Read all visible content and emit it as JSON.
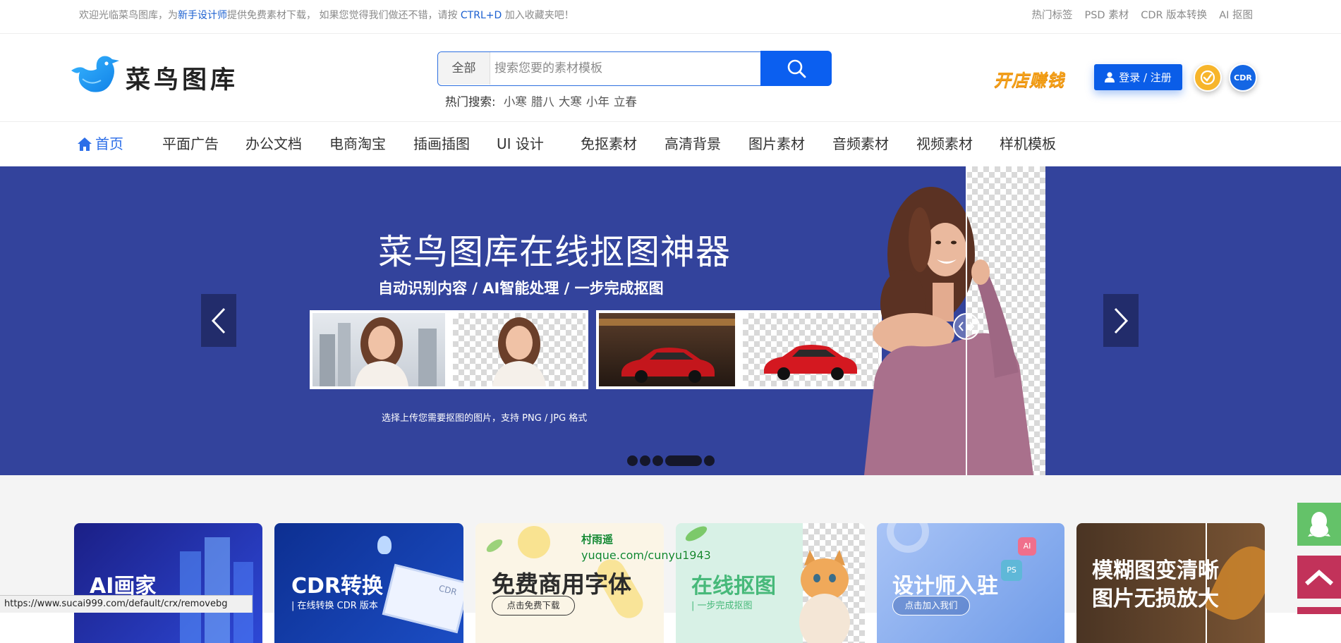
{
  "top_bar": {
    "welcome_prefix": "欢迎光临菜鸟图库，为",
    "welcome_link": "新手设计师",
    "welcome_mid": "提供免费素材下载， 如果您觉得我们做还不错，请按 ",
    "shortcut": "CTRL+D",
    "welcome_suffix": " 加入收藏夹吧！",
    "links": [
      "热门标签",
      "PSD 素材",
      "CDR 版本转换",
      "AI 抠图"
    ]
  },
  "header": {
    "logo_text": "菜鸟图库",
    "search": {
      "category": "全部",
      "placeholder": "搜索您要的素材模板"
    },
    "hot_search": {
      "label": "热门搜索:",
      "terms": [
        "小寒",
        "腊八",
        "大寒",
        "小年",
        "立春"
      ]
    },
    "promo": "开店赚钱",
    "login": "登录 / 注册",
    "cdr_badge": "CDR"
  },
  "nav": {
    "items": [
      "首页",
      "平面广告",
      "办公文档",
      "电商淘宝",
      "插画插图",
      "UI 设计",
      "免抠素材",
      "高清背景",
      "图片素材",
      "音频素材",
      "视频素材",
      "样机模板"
    ],
    "active": "首页"
  },
  "banner": {
    "title": "菜鸟图库在线抠图神器",
    "subtitle": "自动识别内容 / AI智能处理 / 一步完成抠图",
    "note": "选择上传您需要抠图的图片，支持 PNG / JPG 格式",
    "slides": {
      "count": 5,
      "active": 4
    }
  },
  "cards": [
    {
      "title": "AI画家"
    },
    {
      "title": "CDR转换",
      "sub": "| 在线转换 CDR 版本",
      "screen_label": "CDR"
    },
    {
      "title": "免费商用字体",
      "button": "点击免费下载"
    },
    {
      "title": "在线抠图",
      "sub": "| 一步完成抠图"
    },
    {
      "title": "设计师入驻",
      "button": "点击加入我们",
      "badges": [
        "PS",
        "AI"
      ]
    },
    {
      "title": "模糊图变清晰",
      "title2": "图片无损放大"
    }
  ],
  "watermark": {
    "line1": "村雨遥",
    "line2": "yuque.com/cunyu1943"
  },
  "status_url": "https://www.sucai999.com/default/crx/removebg",
  "icons": {
    "logo": "bird-logo-icon",
    "search": "search-icon",
    "home": "house-icon",
    "user": "user-icon",
    "badge": "check-circle-icon",
    "qq": "penguin-icon",
    "back_to_top": "arrow-up-icon",
    "prev": "chevron-left-icon",
    "next": "chevron-right-icon"
  },
  "colors": {
    "brand_blue": "#0b5ff0",
    "banner_bg": "#33439c",
    "nav_active": "#2c6ee8",
    "promo_orange": "#f3a11a",
    "qq_green": "#64c269",
    "to_top_red": "#c2325a",
    "watermark_green": "#12862b"
  }
}
